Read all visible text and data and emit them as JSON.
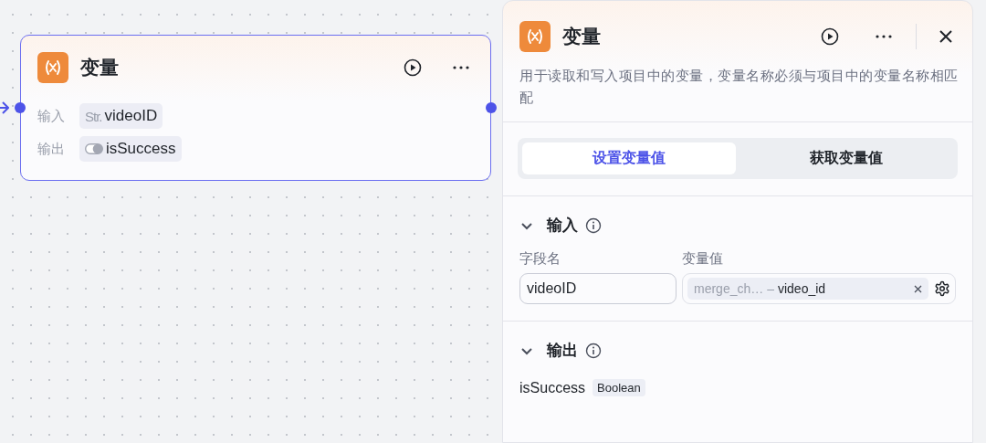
{
  "node": {
    "title": "变量",
    "rows": [
      {
        "label": "输入",
        "kind": "string",
        "type_tag": "Str.",
        "name": "videoID"
      },
      {
        "label": "输出",
        "kind": "boolean",
        "name": "isSuccess"
      }
    ]
  },
  "panel": {
    "title": "变量",
    "description": "用于读取和写入项目中的变量，变量名称必须与项目中的变量名称相匹配",
    "tabs": [
      {
        "label": "设置变量值",
        "selected": true
      },
      {
        "label": "获取变量值",
        "selected": false
      }
    ],
    "input_section": {
      "title": "输入",
      "expanded": true,
      "columns": [
        "字段名",
        "变量值"
      ],
      "field_value": "videoID",
      "reference": {
        "source": "merge_ch…",
        "separator": "–",
        "variable": "video_id"
      }
    },
    "output_section": {
      "title": "输出",
      "expanded": true,
      "name": "isSuccess",
      "type": "Boolean"
    }
  }
}
